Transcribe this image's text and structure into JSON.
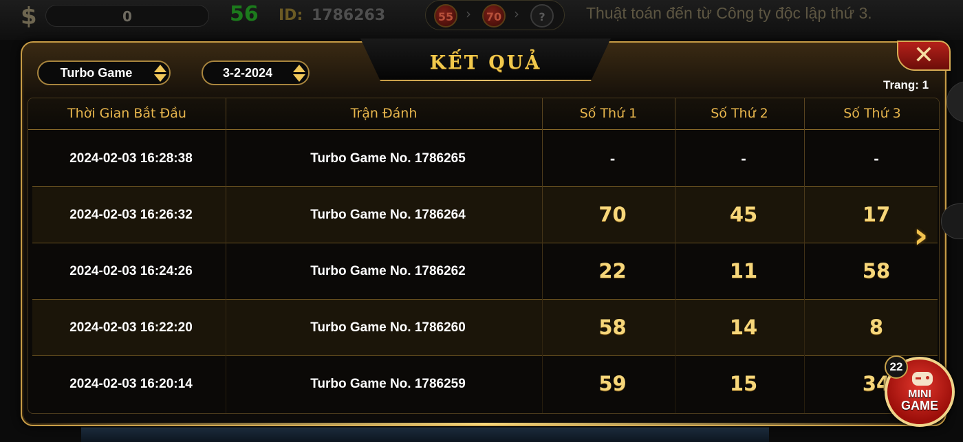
{
  "hud": {
    "currency_icon": "$",
    "balance": "0",
    "counter": "56",
    "id_label": "ID:",
    "id_value": "1786263",
    "history": [
      "55",
      "70",
      "?"
    ],
    "ticker": "Thuật toán đến từ Công ty độc lập thứ 3."
  },
  "modal": {
    "title": "KẾT QUẢ",
    "close_label": "✕",
    "game_select": "Turbo Game",
    "date_select": "3-2-2024",
    "page_info": "Trang: 1",
    "next_label": "›"
  },
  "table": {
    "headers": [
      "Thời Gian Bắt Đầu",
      "Trận Đánh",
      "Số Thứ 1",
      "Số Thứ 2",
      "Số Thứ 3"
    ],
    "rows": [
      {
        "time": "2024-02-03 16:28:38",
        "match": "Turbo Game No. 1786265",
        "n1": "-",
        "n2": "-",
        "n3": "-"
      },
      {
        "time": "2024-02-03 16:26:32",
        "match": "Turbo Game No. 1786264",
        "n1": "70",
        "n2": "45",
        "n3": "17"
      },
      {
        "time": "2024-02-03 16:24:26",
        "match": "Turbo Game No. 1786262",
        "n1": "22",
        "n2": "11",
        "n3": "58"
      },
      {
        "time": "2024-02-03 16:22:20",
        "match": "Turbo Game No. 1786260",
        "n1": "58",
        "n2": "14",
        "n3": "8"
      },
      {
        "time": "2024-02-03 16:20:14",
        "match": "Turbo Game No. 1786259",
        "n1": "59",
        "n2": "15",
        "n3": "34"
      }
    ]
  },
  "minigame": {
    "line1": "MINI",
    "line2": "GAME",
    "badge": "22",
    "icon": "gamepad-icon"
  },
  "colors": {
    "gold": "#f2c94c",
    "header_text": "#e8b64d",
    "panel_border": "#c79c46",
    "close_red": "#b5211a"
  }
}
